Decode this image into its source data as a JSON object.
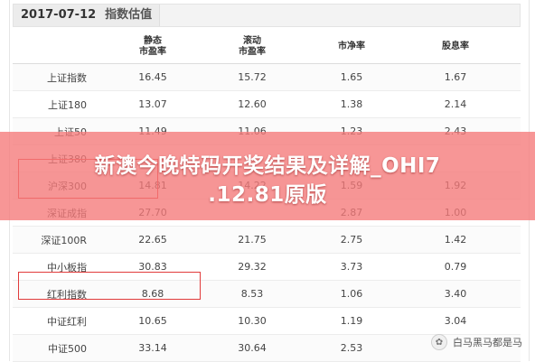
{
  "header": {
    "date": "2017-07-12",
    "subtitle": "指数估值"
  },
  "table": {
    "columns": [
      {
        "line1": "",
        "line2": ""
      },
      {
        "line1": "静态",
        "line2": "市盈率"
      },
      {
        "line1": "滚动",
        "line2": "市盈率"
      },
      {
        "line1": "市净率",
        "line2": ""
      },
      {
        "line1": "股息率",
        "line2": ""
      }
    ],
    "rows": [
      {
        "name": "上证指数",
        "pe_static": "16.45",
        "pe_ttm": "15.72",
        "pb": "1.65",
        "dividend": "1.67"
      },
      {
        "name": "上证180",
        "pe_static": "13.07",
        "pe_ttm": "12.60",
        "pb": "1.38",
        "dividend": "2.14"
      },
      {
        "name": "上证50",
        "pe_static": "11.49",
        "pe_ttm": "11.06",
        "pb": "1.23",
        "dividend": "2.43"
      },
      {
        "name": "上证380",
        "pe_static": "",
        "pe_ttm": "",
        "pb": "",
        "dividend": ""
      },
      {
        "name": "沪深300",
        "pe_static": "14.81",
        "pe_ttm": "14.22",
        "pb": "1.59",
        "dividend": "1.92"
      },
      {
        "name": "深证成指",
        "pe_static": "27.70",
        "pe_ttm": "",
        "pb": "2.87",
        "dividend": "1.00"
      },
      {
        "name": "深证100R",
        "pe_static": "22.65",
        "pe_ttm": "21.75",
        "pb": "2.75",
        "dividend": "1.42"
      },
      {
        "name": "中小板指",
        "pe_static": "30.83",
        "pe_ttm": "29.32",
        "pb": "3.73",
        "dividend": "0.79"
      },
      {
        "name": "红利指数",
        "pe_static": "8.68",
        "pe_ttm": "8.53",
        "pb": "1.06",
        "dividend": "3.40"
      },
      {
        "name": "中证红利",
        "pe_static": "10.65",
        "pe_ttm": "10.30",
        "pb": "1.19",
        "dividend": "3.04"
      },
      {
        "name": "中证500",
        "pe_static": "33.14",
        "pe_ttm": "30.64",
        "pb": "2.53",
        "dividend": ""
      }
    ]
  },
  "banner": {
    "line1": "新澳今晚特码开奖结果及详解_OHI7",
    "line2": ".12.81原版"
  },
  "watermark": {
    "text": "白马黑马都是马",
    "icon": "paw-icon"
  },
  "colors": {
    "highlight": "#e13b3b",
    "banner": "#f57878"
  }
}
